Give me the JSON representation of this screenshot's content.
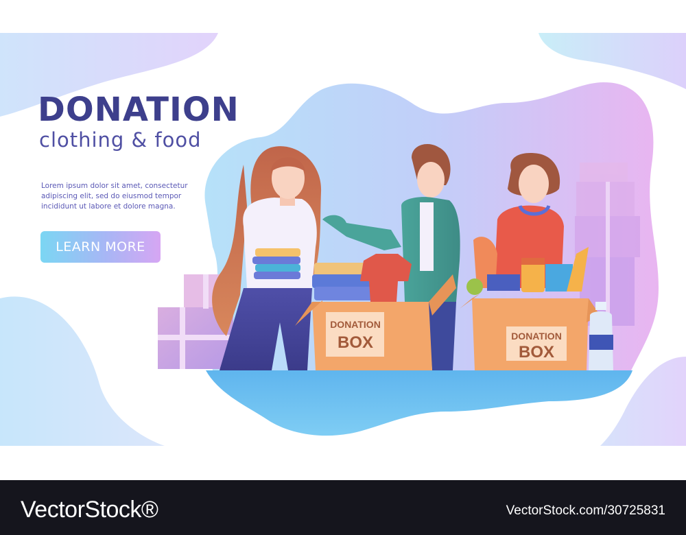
{
  "hero": {
    "title": "DONATION",
    "subtitle": "clothing & food",
    "body_lines": [
      "Lorem ipsum dolor sit amet, consectetur",
      "adipiscing elit, sed do eiusmod tempor",
      "incididunt ut labore et dolore magna."
    ],
    "cta_label": "LEARN MORE"
  },
  "scene": {
    "box_left": {
      "line1": "DONATION",
      "line2": "BOX"
    },
    "box_right": {
      "line1": "DONATION",
      "line2": "BOX"
    }
  },
  "footer": {
    "brand": "VectorStock®",
    "image_id": "VectorStock.com/30725831"
  },
  "colors": {
    "title": "#3d3f8c",
    "body_text": "#5a58b5",
    "cta_gradient": [
      "#7bd6f3",
      "#a8b6f5",
      "#d6a6f3"
    ],
    "footer_bg": "#15151d",
    "box": "#f3a66a"
  },
  "icons": [
    "none"
  ]
}
